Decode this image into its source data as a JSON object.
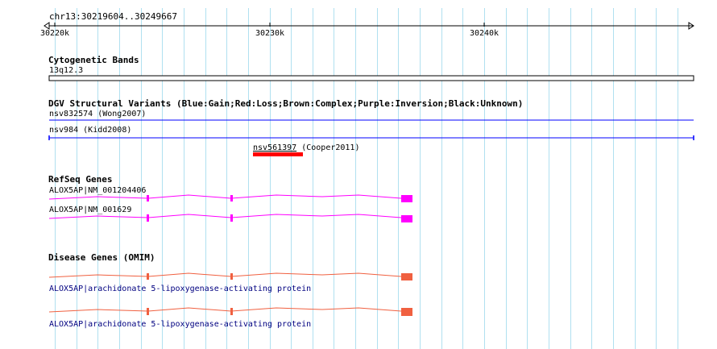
{
  "ruler": {
    "location": "chr13:30219604..30249667",
    "ticks": [
      "30220k",
      "30230k",
      "30240k"
    ]
  },
  "tracks": {
    "cytoband": {
      "title": "Cytogenetic Bands",
      "label": "13q12.3"
    },
    "dgv": {
      "title": "DGV Structural Variants (Blue:Gain;Red:Loss;Brown:Complex;Purple:Inversion;Black:Unknown)",
      "features": [
        {
          "id": "nsv832574",
          "note": "(Wong2007)",
          "color": "#0000ff"
        },
        {
          "id": "nsv984",
          "note": "(Kidd2008)",
          "color": "#0000ff"
        },
        {
          "id": "nsv561397",
          "note": "(Cooper2011)",
          "color": "#ff0000"
        }
      ]
    },
    "refseq": {
      "title": "RefSeq Genes",
      "color": "#ff00ff",
      "genes": [
        {
          "label": "ALOX5AP|NM_001204406"
        },
        {
          "label": "ALOX5AP|NM_001629"
        }
      ]
    },
    "omim": {
      "title": "Disease Genes (OMIM)",
      "color": "#f06040",
      "label_color": "#000080",
      "genes": [
        {
          "label": "ALOX5AP|arachidonate 5-lipoxygenase-activating protein"
        },
        {
          "label": "ALOX5AP|arachidonate 5-lipoxygenase-activating protein"
        }
      ]
    }
  },
  "colors": {
    "grid": "#b0e0f0",
    "gain": "#0000ff",
    "loss": "#ff0000",
    "refseq": "#ff00ff",
    "omim": "#f06040"
  }
}
